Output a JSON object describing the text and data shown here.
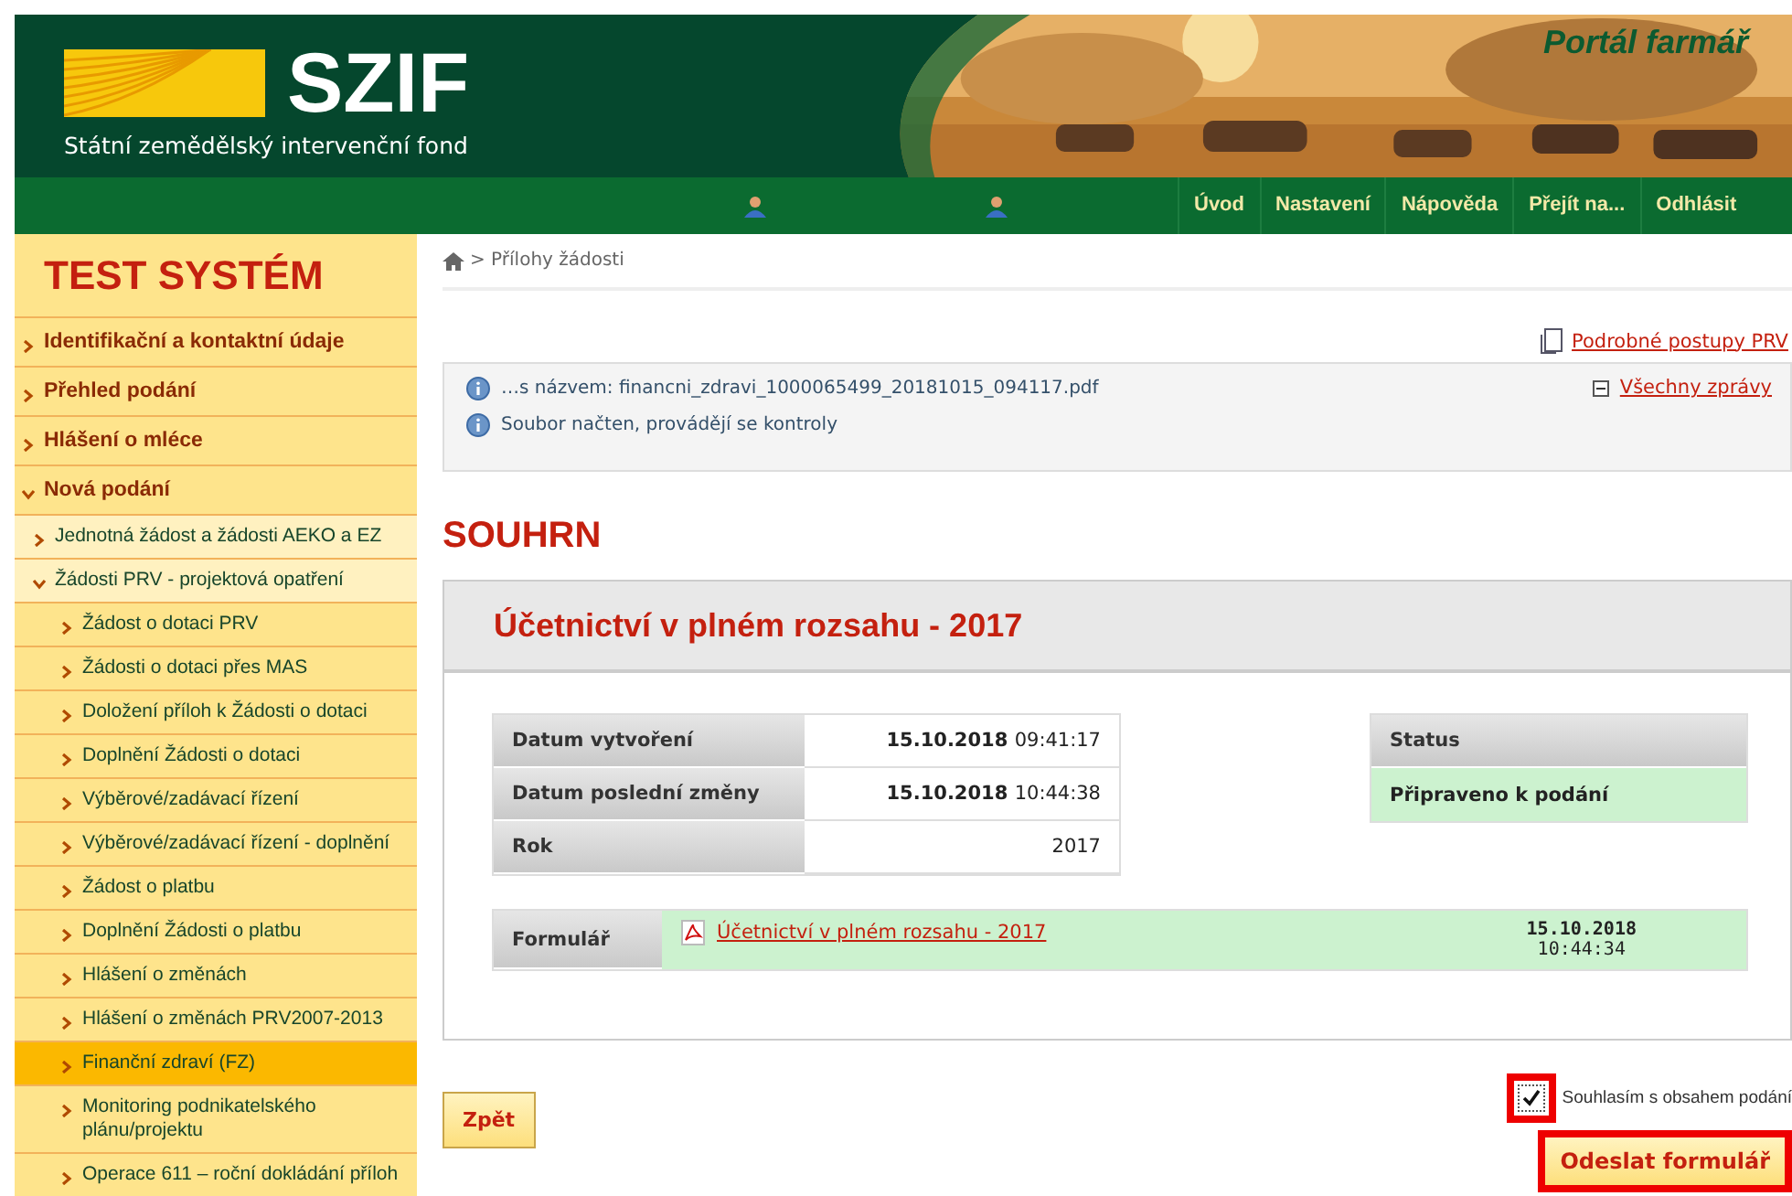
{
  "header": {
    "logo_text": "SZIF",
    "logo_subtitle": "Státní zemědělský intervenční fond",
    "portal_title": "Portál farmář"
  },
  "nav": {
    "items": [
      "Úvod",
      "Nastavení",
      "Nápověda",
      "Přejít na...",
      "Odhlásit"
    ]
  },
  "sidebar": {
    "title": "TEST SYSTÉM",
    "items": [
      {
        "label": "Identifikační a kontaktní údaje",
        "expanded": false,
        "selected": false
      },
      {
        "label": "Přehled podání",
        "expanded": false,
        "selected": false
      },
      {
        "label": "Hlášení o mléce",
        "expanded": false,
        "selected": false
      },
      {
        "label": "Nová podání",
        "expanded": true,
        "selected": false,
        "children": [
          {
            "label": "Jednotná žádost a žádosti AEKO a EZ",
            "expanded": false,
            "selected": false
          },
          {
            "label": "Žádosti PRV - projektová opatření",
            "expanded": true,
            "selected": false,
            "children": [
              {
                "label": "Žádost o dotaci PRV",
                "expanded": false,
                "selected": false
              },
              {
                "label": "Žádosti o dotaci přes MAS",
                "expanded": false,
                "selected": false
              },
              {
                "label": "Doložení příloh k Žádosti o dotaci",
                "expanded": false,
                "selected": false
              },
              {
                "label": "Doplnění Žádosti o dotaci",
                "expanded": false,
                "selected": false
              },
              {
                "label": "Výběrové/zadávací řízení",
                "expanded": false,
                "selected": false
              },
              {
                "label": "Výběrové/zadávací řízení - doplnění",
                "expanded": false,
                "selected": false
              },
              {
                "label": "Žádost o platbu",
                "expanded": false,
                "selected": false
              },
              {
                "label": "Doplnění Žádosti o platbu",
                "expanded": false,
                "selected": false
              },
              {
                "label": "Hlášení o změnách",
                "expanded": false,
                "selected": false
              },
              {
                "label": "Hlášení o změnách PRV2007-2013",
                "expanded": false,
                "selected": false
              },
              {
                "label": "Finanční zdraví (FZ)",
                "expanded": false,
                "selected": true
              },
              {
                "label": "Monitoring podnikatelského plánu/projektu",
                "expanded": false,
                "selected": false
              },
              {
                "label": "Operace 611 – roční dokládání příloh",
                "expanded": false,
                "selected": false
              }
            ]
          }
        ]
      }
    ]
  },
  "breadcrumb": "> Přílohy žádosti",
  "help_link": "Podrobné postupy PRV",
  "messages": [
    {
      "text": "…s názvem: financni_zdravi_1000065499_20181015_094117.pdf"
    },
    {
      "text": "Soubor načten, provádějí se kontroly"
    }
  ],
  "all_messages_link": "Všechny zprávy",
  "section_title": "SOUHRN",
  "card": {
    "title": "Účetnictví v plném rozsahu - 2017",
    "details": [
      {
        "label": "Datum vytvoření",
        "date": "15.10.2018",
        "time": "09:41:17"
      },
      {
        "label": "Datum poslední změny",
        "date": "15.10.2018",
        "time": "10:44:38"
      },
      {
        "label": "Rok",
        "time": "2017"
      }
    ],
    "status": {
      "label": "Status",
      "value": "Připraveno k podání"
    },
    "form": {
      "label": "Formulář",
      "link": "Účetnictví v plném rozsahu - 2017",
      "date": "15.10.2018",
      "time": "10:44:34"
    }
  },
  "back_button": "Zpět",
  "agree": {
    "label": "Souhlasím s obsahem podání",
    "checked": true,
    "highlighted": true
  },
  "submit": {
    "label": "Odeslat formulář",
    "highlighted": true
  }
}
